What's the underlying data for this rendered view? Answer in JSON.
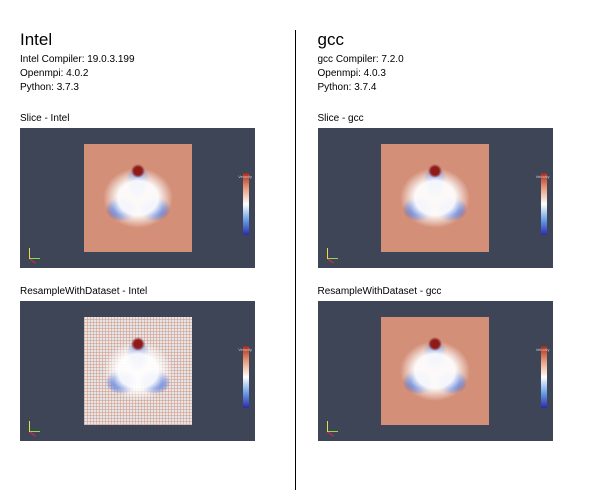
{
  "left": {
    "title": "Intel",
    "compiler": "Intel Compiler: 19.0.3.199",
    "openmpi": "Openmpi: 4.0.2",
    "python": "Python: 3.7.3",
    "slice_label": "Slice - Intel",
    "resample_label": "ResampleWithDataset - Intel"
  },
  "right": {
    "title": "gcc",
    "compiler": "gcc Compiler: 7.2.0",
    "openmpi": "Openmpi: 4.0.3",
    "python": "Python: 3.7.4",
    "slice_label": "Slice - gcc",
    "resample_label": "ResampleWithDataset - gcc"
  },
  "legend": {
    "title": "Velocity"
  }
}
